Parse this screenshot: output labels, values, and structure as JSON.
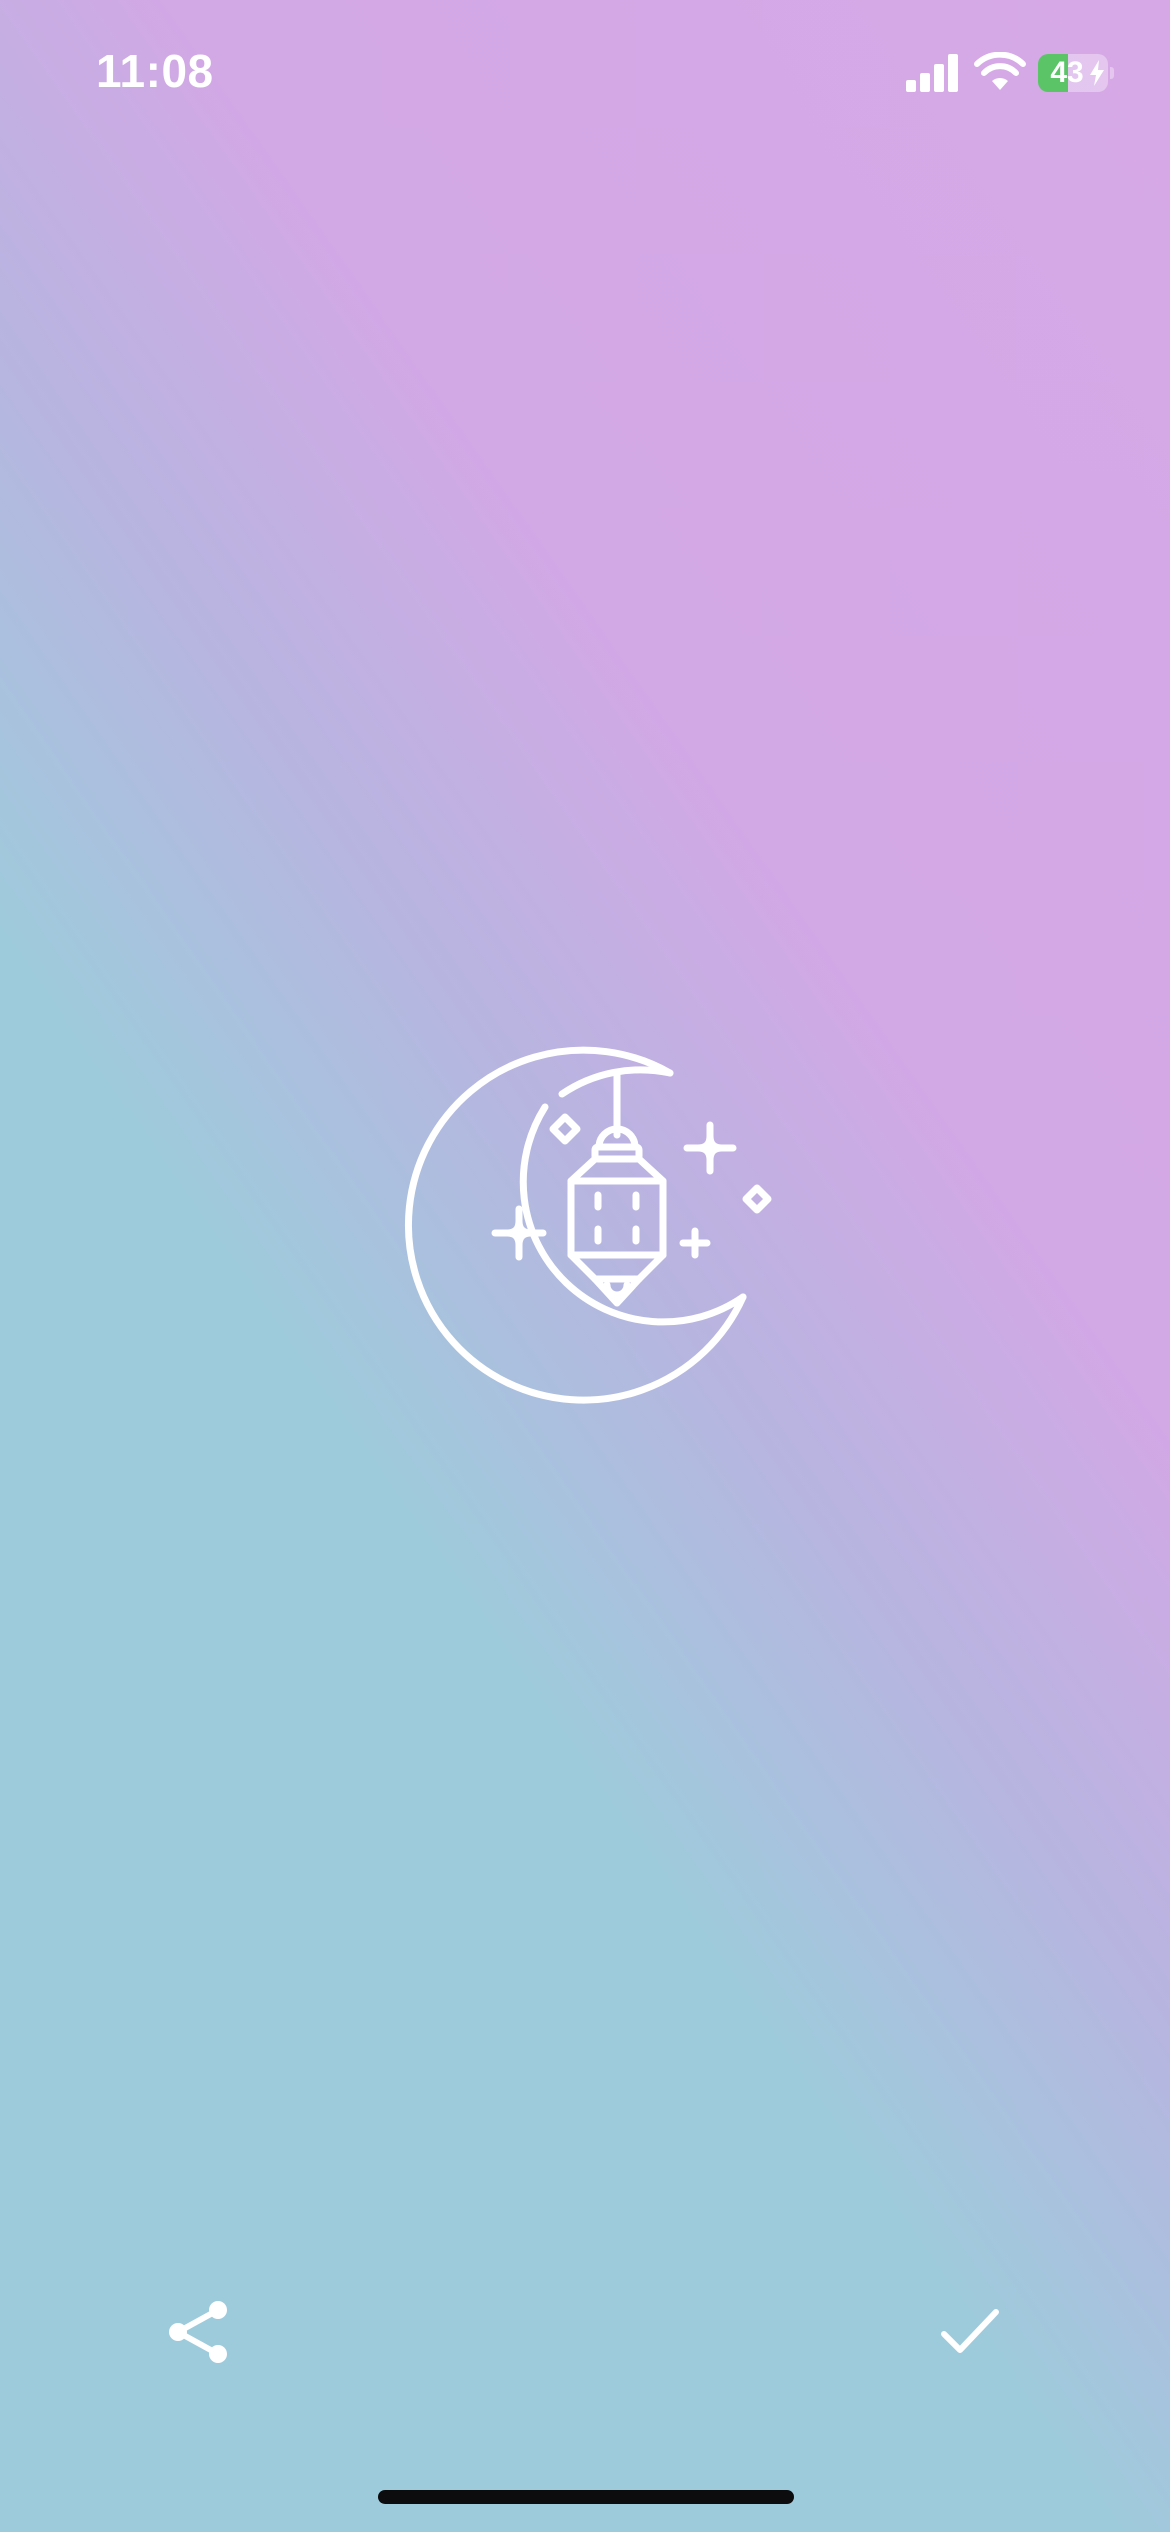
{
  "status_bar": {
    "time": "11:08",
    "battery_level": "43",
    "battery_fraction": 0.43,
    "battery_charging": true,
    "signal_icon": "cellular-signal-icon",
    "wifi_icon": "wifi-icon"
  },
  "emblem": {
    "icon": "crescent-moon-lantern-icon"
  },
  "toolbar": {
    "share_icon": "share-icon",
    "confirm_icon": "checkmark-icon"
  },
  "colors": {
    "gradient_teal": "#9ecbdc",
    "gradient_lavender": "#b7b5e0",
    "gradient_pink": "#d6a8e6",
    "battery_green": "#5ac467",
    "foreground": "#ffffff"
  }
}
